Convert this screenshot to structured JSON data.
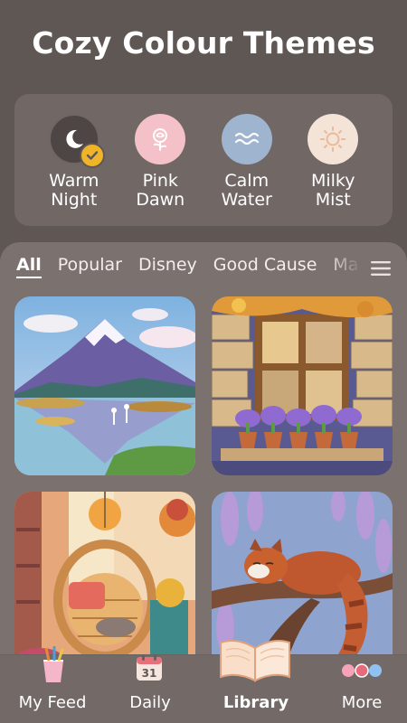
{
  "header": {
    "title": "Cozy Colour Themes"
  },
  "themes": [
    {
      "label": "Warm\nNight",
      "icon": "moon-icon",
      "color": "#4e4644",
      "selected": true
    },
    {
      "label": "Pink\nDawn",
      "icon": "rose-icon",
      "color": "#f3c1c7"
    },
    {
      "label": "Calm\nWater",
      "icon": "waves-icon",
      "color": "#9fb4cf"
    },
    {
      "label": "Milky\nMist",
      "icon": "sun-icon",
      "color": "#f4e3d7"
    }
  ],
  "tabs": {
    "items": [
      "All",
      "Popular",
      "Disney",
      "Good Cause",
      "Ma"
    ],
    "active": "All"
  },
  "gallery": [
    {
      "subject": "mountain-lake",
      "icon": "mountain-lake-image"
    },
    {
      "subject": "window-with-flowers",
      "icon": "window-flowers-image"
    },
    {
      "subject": "hanging-chair-cat",
      "icon": "hanging-chair-image"
    },
    {
      "subject": "red-panda",
      "icon": "red-panda-image"
    }
  ],
  "nav": {
    "items": [
      {
        "label": "My Feed",
        "icon": "cup-brushes-icon"
      },
      {
        "label": "Daily",
        "icon": "calendar-icon",
        "badge": "31"
      },
      {
        "label": "Library",
        "icon": "book-icon",
        "active": true
      },
      {
        "label": "More",
        "icon": "dots-icon"
      }
    ]
  },
  "colors": {
    "background": "#5f5754",
    "accent": "#f0b429",
    "sheet": "#7b7270"
  }
}
